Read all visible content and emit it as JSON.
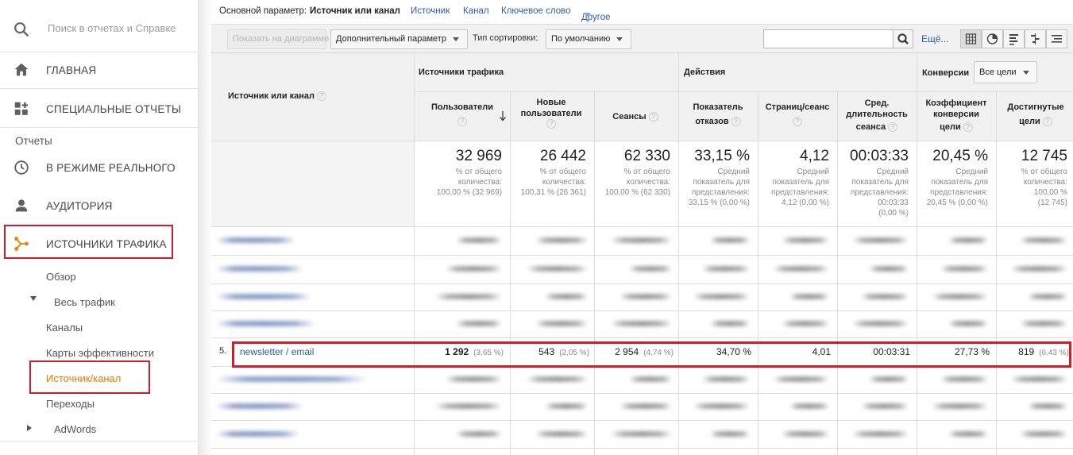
{
  "search": {
    "placeholder": "Поиск в отчетах и Справке"
  },
  "nav": {
    "home": "ГЛАВНАЯ",
    "custom_reports": "СПЕЦИАЛЬНЫЕ ОТЧЕТЫ",
    "reports_section": "Отчеты",
    "realtime": "В РЕЖИМЕ РЕАЛЬНОГО",
    "audience": "АУДИТОРИЯ",
    "acquisition": "ИСТОЧНИКИ ТРАФИКА",
    "sub": {
      "overview": "Обзор",
      "all_traffic": "Весь трафик",
      "channels": "Каналы",
      "treemaps": "Карты эффективности",
      "source_medium": "Источник/канал",
      "referrals": "Переходы",
      "adwords": "AdWords"
    }
  },
  "primary_dimension": {
    "label": "Основной параметр:",
    "active": "Источник или канал",
    "links": [
      "Источник",
      "Канал",
      "Ключевое слово"
    ],
    "other": "Другое"
  },
  "toolbar": {
    "plot_rows": "Показать на диаграмме",
    "secondary_dimension": "Дополнительный параметр",
    "sort_type_label": "Тип сортировки:",
    "sort_type_value": "По умолчанию",
    "more": "Ещё..."
  },
  "table": {
    "dimension_header": "Источник или канал",
    "groups": {
      "acquisition": "Источники трафика",
      "behavior": "Действия",
      "conversions": "Конверсии",
      "goal_select": "Все цели"
    },
    "columns": [
      {
        "l1": "Пользователи",
        "l2": ""
      },
      {
        "l1": "Новые",
        "l2": "пользователи"
      },
      {
        "l1": "Сеансы",
        "l2": ""
      },
      {
        "l1": "Показатель",
        "l2": "отказов"
      },
      {
        "l1": "Страниц/сеанс",
        "l2": ""
      },
      {
        "l1": "Сред.",
        "l2": "длительность",
        "l3": "сеанса"
      },
      {
        "l1": "Коэффициент",
        "l2": "конверсии",
        "l3": "цели"
      },
      {
        "l1": "Достигнутые",
        "l2": "цели"
      }
    ],
    "totals": [
      {
        "value": "32 969",
        "s1": "% от общего",
        "s2": "количества:",
        "s3": "100,00 % (32 969)",
        "s4": ""
      },
      {
        "value": "26 442",
        "s1": "% от общего",
        "s2": "количества:",
        "s3": "100,31 % (26 361)",
        "s4": ""
      },
      {
        "value": "62 330",
        "s1": "% от общего",
        "s2": "количества:",
        "s3": "100,00 % (62 330)",
        "s4": ""
      },
      {
        "value": "33,15 %",
        "s1": "Средний",
        "s2": "показатель для",
        "s3": "представления:",
        "s4": "33,15 % (0,00 %)"
      },
      {
        "value": "4,12",
        "s1": "Средний",
        "s2": "показатель для",
        "s3": "представления:",
        "s4": "4,12 (0,00 %)"
      },
      {
        "value": "00:03:33",
        "s1": "Средний",
        "s2": "показатель для",
        "s3": "представления:",
        "s4": "00:03:33",
        "s5": "(0,00 %)"
      },
      {
        "value": "20,45 %",
        "s1": "Средний",
        "s2": "показатель для",
        "s3": "представления:",
        "s4": "20,45 % (0,00 %)"
      },
      {
        "value": "12 745",
        "s1": "% от общего",
        "s2": "количества:",
        "s3": "100,00 %",
        "s4": "(12 745)"
      }
    ],
    "highlight_row": {
      "index": "5.",
      "name": "newsletter / email",
      "users": "1 292",
      "users_pct": "(3,65 %)",
      "new_users": "543",
      "new_users_pct": "(2,05 %)",
      "sessions": "2 954",
      "sessions_pct": "(4,74 %)",
      "bounce": "34,70 %",
      "pages": "4,01",
      "duration": "00:03:31",
      "conv_rate": "27,73 %",
      "goals": "819",
      "goals_pct": "(6,43 %)"
    }
  },
  "colors": {
    "accent_orange": "#f57c00",
    "highlight_red": "#cc1f2a",
    "link_blue": "#2a5db0"
  }
}
